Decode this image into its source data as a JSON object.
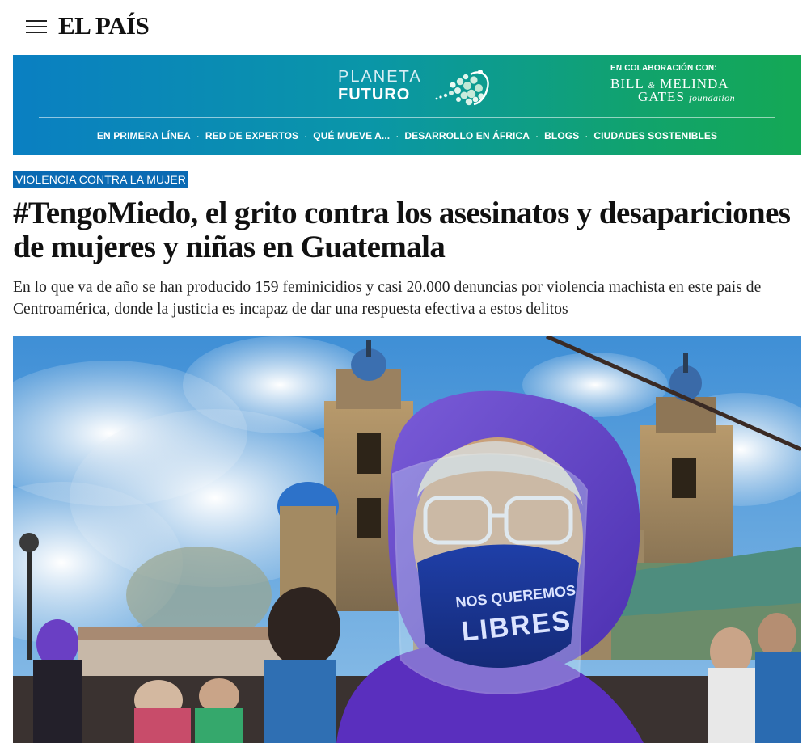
{
  "header": {
    "logo_text": "EL PAÍS",
    "menu_icon": "hamburger-menu-icon"
  },
  "banner": {
    "brand_line1": "PLANETA",
    "brand_line2": "FUTURO",
    "collab_label": "EN COLABORACIÓN CON:",
    "partner_line1_a": "BILL",
    "partner_line1_amp": "&",
    "partner_line1_b": "MELINDA",
    "partner_line2_a": "GATES",
    "partner_line2_b": "foundation",
    "nav": [
      {
        "label": "EN PRIMERA LÍNEA"
      },
      {
        "label": "RED DE EXPERTOS"
      },
      {
        "label": "QUÉ MUEVE A..."
      },
      {
        "label": "DESARROLLO EN ÁFRICA"
      },
      {
        "label": "BLOGS"
      },
      {
        "label": "CIUDADES SOSTENIBLES"
      }
    ],
    "separator": "·",
    "colors": {
      "gradient_start": "#0a7fc2",
      "gradient_end": "#14a855"
    }
  },
  "article": {
    "kicker": "VIOLENCIA CONTRA LA MUJER",
    "headline": "#TengoMiedo, el grito contra los asesinatos y desapariciones de mujeres y niñas en Guatemala",
    "subhead": "En lo que va de año se han producido 159 feminicidios y casi 20.000 denuncias por violencia machista en este país de Centroamérica, donde la justicia es incapaz de dar una respuesta efectiva a estos delitos",
    "photo": {
      "mask_text_line1": "NOS QUEREMOS",
      "mask_text_line2": "LIBRES"
    },
    "colors": {
      "kicker_bg": "#0a6ab3"
    }
  }
}
